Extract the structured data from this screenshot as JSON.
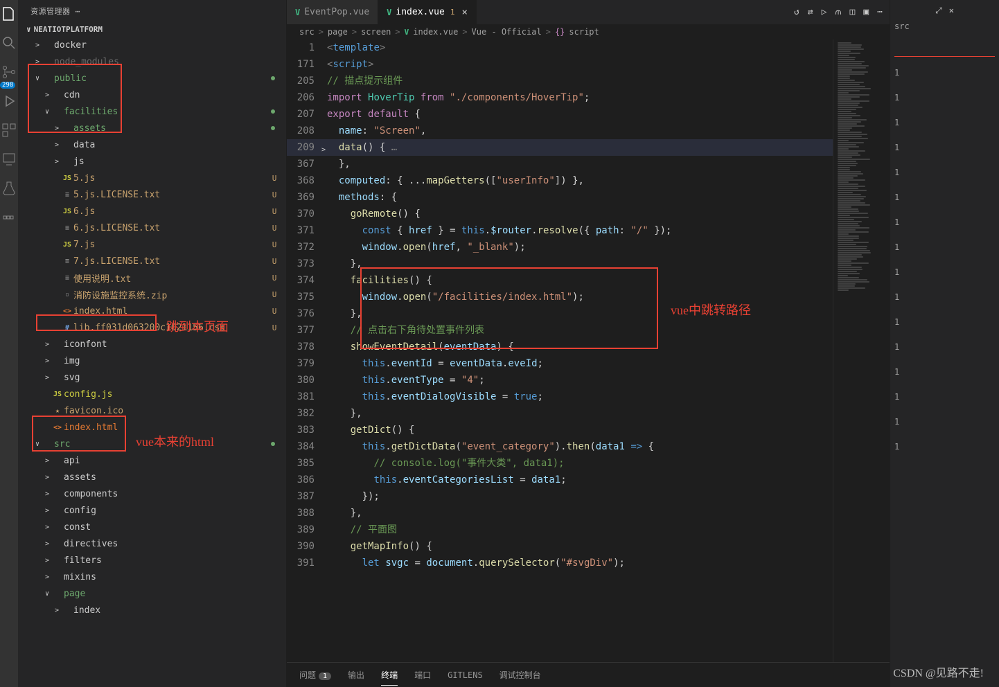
{
  "sidebar": {
    "title": "资源管理器",
    "project": "NEATIOTPLATFORM",
    "badge": "298",
    "tree": [
      {
        "depth": 1,
        "chev": ">",
        "icon": "",
        "cls": "",
        "label": "docker"
      },
      {
        "depth": 1,
        "chev": ">",
        "icon": "",
        "cls": "gray-icon",
        "label": "node_modules",
        "muted": true
      },
      {
        "depth": 1,
        "chev": "∨",
        "icon": "",
        "cls": "green",
        "label": "public",
        "dot": true
      },
      {
        "depth": 2,
        "chev": ">",
        "icon": "",
        "cls": "",
        "label": "cdn"
      },
      {
        "depth": 2,
        "chev": "∨",
        "icon": "",
        "cls": "green",
        "label": "facilities",
        "dot": true
      },
      {
        "depth": 3,
        "chev": ">",
        "icon": "",
        "cls": "green",
        "label": "assets",
        "dot": true
      },
      {
        "depth": 3,
        "chev": ">",
        "icon": "",
        "cls": "",
        "label": "data"
      },
      {
        "depth": 3,
        "chev": ">",
        "icon": "",
        "cls": "",
        "label": "js"
      },
      {
        "depth": 3,
        "chev": "",
        "icon": "JS",
        "cls": "js-icon yellow",
        "label": "5.js",
        "status": "U"
      },
      {
        "depth": 3,
        "chev": "",
        "icon": "≡",
        "cls": "txt-icon yellow",
        "label": "5.js.LICENSE.txt",
        "status": "U"
      },
      {
        "depth": 3,
        "chev": "",
        "icon": "JS",
        "cls": "js-icon yellow",
        "label": "6.js",
        "status": "U"
      },
      {
        "depth": 3,
        "chev": "",
        "icon": "≡",
        "cls": "txt-icon yellow",
        "label": "6.js.LICENSE.txt",
        "status": "U"
      },
      {
        "depth": 3,
        "chev": "",
        "icon": "JS",
        "cls": "js-icon yellow",
        "label": "7.js",
        "status": "U"
      },
      {
        "depth": 3,
        "chev": "",
        "icon": "≡",
        "cls": "txt-icon yellow",
        "label": "7.js.LICENSE.txt",
        "status": "U"
      },
      {
        "depth": 3,
        "chev": "",
        "icon": "≡",
        "cls": "txt-icon yellow",
        "label": "使用说明.txt",
        "status": "U"
      },
      {
        "depth": 3,
        "chev": "",
        "icon": "▫",
        "cls": "gray-icon yellow",
        "label": "消防设施监控系统.zip",
        "status": "U"
      },
      {
        "depth": 3,
        "chev": "",
        "icon": "<>",
        "cls": "html-icon yellow",
        "label": "index.html",
        "status": "U"
      },
      {
        "depth": 3,
        "chev": "",
        "icon": "#",
        "cls": "css-icon yellow",
        "label": "lib.ff031d063200c1021156.css",
        "status": "U"
      },
      {
        "depth": 2,
        "chev": ">",
        "icon": "",
        "cls": "",
        "label": "iconfont"
      },
      {
        "depth": 2,
        "chev": ">",
        "icon": "",
        "cls": "",
        "label": "img"
      },
      {
        "depth": 2,
        "chev": ">",
        "icon": "",
        "cls": "",
        "label": "svg"
      },
      {
        "depth": 2,
        "chev": "",
        "icon": "JS",
        "cls": "js-icon",
        "label": "config.js"
      },
      {
        "depth": 2,
        "chev": "",
        "icon": "★",
        "cls": "star-icon",
        "label": "favicon.ico"
      },
      {
        "depth": 2,
        "chev": "",
        "icon": "<>",
        "cls": "html-icon",
        "label": "index.html"
      },
      {
        "depth": 1,
        "chev": "∨",
        "icon": "",
        "cls": "green",
        "label": "src",
        "dot": true
      },
      {
        "depth": 2,
        "chev": ">",
        "icon": "",
        "cls": "",
        "label": "api"
      },
      {
        "depth": 2,
        "chev": ">",
        "icon": "",
        "cls": "",
        "label": "assets"
      },
      {
        "depth": 2,
        "chev": ">",
        "icon": "",
        "cls": "",
        "label": "components"
      },
      {
        "depth": 2,
        "chev": ">",
        "icon": "",
        "cls": "",
        "label": "config"
      },
      {
        "depth": 2,
        "chev": ">",
        "icon": "",
        "cls": "",
        "label": "const"
      },
      {
        "depth": 2,
        "chev": ">",
        "icon": "",
        "cls": "",
        "label": "directives"
      },
      {
        "depth": 2,
        "chev": ">",
        "icon": "",
        "cls": "",
        "label": "filters"
      },
      {
        "depth": 2,
        "chev": ">",
        "icon": "",
        "cls": "",
        "label": "mixins"
      },
      {
        "depth": 2,
        "chev": "∨",
        "icon": "",
        "cls": "green",
        "label": "page"
      },
      {
        "depth": 3,
        "chev": ">",
        "icon": "",
        "cls": "",
        "label": "index"
      }
    ]
  },
  "tabs": [
    {
      "icon": "V",
      "label": "EventPop.vue",
      "active": false
    },
    {
      "icon": "V",
      "label": "index.vue",
      "active": true,
      "mod": "1"
    }
  ],
  "breadcrumb": [
    "src",
    "page",
    "screen",
    "index.vue",
    "Vue - Official",
    "script"
  ],
  "code": [
    {
      "n": "1",
      "h": "<span class='c-gray'>&lt;</span><span class='c-tag'>template</span><span class='c-gray'>&gt;</span>"
    },
    {
      "n": "171",
      "h": "<span class='c-gray'>&lt;</span><span class='c-tag'>script</span><span class='c-gray'>&gt;</span>"
    },
    {
      "n": "205",
      "h": "<span class='c-comm'>// 描点提示组件</span>"
    },
    {
      "n": "206",
      "h": "<span class='c-kw'>import</span> <span class='c-cls'>HoverTip</span> <span class='c-kw'>from</span> <span class='c-str'>\"./components/HoverTip\"</span><span class='c-punc'>;</span>"
    },
    {
      "n": "207",
      "h": "<span class='c-kw'>export</span> <span class='c-kw'>default</span> <span class='c-punc'>{</span>"
    },
    {
      "n": "208",
      "h": "  <span class='c-prop'>name</span><span class='c-punc'>:</span> <span class='c-str'>\"Screen\"</span><span class='c-punc'>,</span>"
    },
    {
      "n": "209",
      "sel": true,
      "fold": ">",
      "h": "  <span class='c-fn'>data</span><span class='c-punc'>()</span> <span class='c-punc'>{</span><span class='c-gray'> …</span>"
    },
    {
      "n": "367",
      "h": "  <span class='c-punc'>},</span>"
    },
    {
      "n": "368",
      "h": "  <span class='c-prop'>computed</span><span class='c-punc'>:</span> <span class='c-punc'>{ ...</span><span class='c-fn'>mapGetters</span><span class='c-punc'>([</span><span class='c-str'>\"userInfo\"</span><span class='c-punc'>]) },</span>"
    },
    {
      "n": "369",
      "h": "  <span class='c-prop'>methods</span><span class='c-punc'>:</span> <span class='c-punc'>{</span>"
    },
    {
      "n": "370",
      "h": "    <span class='c-fn'>goRemote</span><span class='c-punc'>()</span> <span class='c-punc'>{</span>"
    },
    {
      "n": "371",
      "h": "      <span class='c-const'>const</span> <span class='c-punc'>{</span> <span class='c-var'>href</span> <span class='c-punc'>}</span> <span class='c-op'>=</span> <span class='c-const'>this</span><span class='c-punc'>.</span><span class='c-var'>$router</span><span class='c-punc'>.</span><span class='c-fn'>resolve</span><span class='c-punc'>({</span> <span class='c-prop'>path</span><span class='c-punc'>:</span> <span class='c-str'>\"/\"</span> <span class='c-punc'>});</span>"
    },
    {
      "n": "372",
      "h": "      <span class='c-var'>window</span><span class='c-punc'>.</span><span class='c-fn'>open</span><span class='c-punc'>(</span><span class='c-var'>href</span><span class='c-punc'>,</span> <span class='c-str'>\"_blank\"</span><span class='c-punc'>);</span>"
    },
    {
      "n": "373",
      "h": "    <span class='c-punc'>},</span>"
    },
    {
      "n": "374",
      "h": "    <span class='c-fn'>facilities</span><span class='c-punc'>()</span> <span class='c-punc'>{</span>"
    },
    {
      "n": "375",
      "h": "      <span class='c-var'>window</span><span class='c-punc'>.</span><span class='c-fn'>open</span><span class='c-punc'>(</span><span class='c-str'>\"/facilities/index.html\"</span><span class='c-punc'>);</span>"
    },
    {
      "n": "376",
      "h": "    <span class='c-punc'>},</span>"
    },
    {
      "n": "377",
      "h": "    <span class='c-comm'>// 点击右下角待处置事件列表</span>"
    },
    {
      "n": "378",
      "h": "    <span class='c-fn'>showEventDetail</span><span class='c-punc'>(</span><span class='c-var'>eventData</span><span class='c-punc'>)</span> <span class='c-punc'>{</span>"
    },
    {
      "n": "379",
      "h": "      <span class='c-const'>this</span><span class='c-punc'>.</span><span class='c-var'>eventId</span> <span class='c-op'>=</span> <span class='c-var'>eventData</span><span class='c-punc'>.</span><span class='c-var'>eveId</span><span class='c-punc'>;</span>"
    },
    {
      "n": "380",
      "h": "      <span class='c-const'>this</span><span class='c-punc'>.</span><span class='c-var'>eventType</span> <span class='c-op'>=</span> <span class='c-str'>\"4\"</span><span class='c-punc'>;</span>"
    },
    {
      "n": "381",
      "h": "      <span class='c-const'>this</span><span class='c-punc'>.</span><span class='c-var'>eventDialogVisible</span> <span class='c-op'>=</span> <span class='c-const'>true</span><span class='c-punc'>;</span>"
    },
    {
      "n": "382",
      "h": "    <span class='c-punc'>},</span>"
    },
    {
      "n": "383",
      "h": "    <span class='c-fn'>getDict</span><span class='c-punc'>()</span> <span class='c-punc'>{</span>"
    },
    {
      "n": "384",
      "h": "      <span class='c-const'>this</span><span class='c-punc'>.</span><span class='c-fn'>getDictData</span><span class='c-punc'>(</span><span class='c-str'>\"event_category\"</span><span class='c-punc'>).</span><span class='c-fn'>then</span><span class='c-punc'>(</span><span class='c-var'>data1</span> <span class='c-const'>=&gt;</span> <span class='c-punc'>{</span>"
    },
    {
      "n": "385",
      "h": "        <span class='c-comm'>// console.log(\"事件大类\", data1);</span>"
    },
    {
      "n": "386",
      "h": "        <span class='c-const'>this</span><span class='c-punc'>.</span><span class='c-var'>eventCategoriesList</span> <span class='c-op'>=</span> <span class='c-var'>data1</span><span class='c-punc'>;</span>"
    },
    {
      "n": "387",
      "h": "      <span class='c-punc'>});</span>"
    },
    {
      "n": "388",
      "h": "    <span class='c-punc'>},</span>"
    },
    {
      "n": "389",
      "h": "    <span class='c-comm'>// 平面图</span>"
    },
    {
      "n": "390",
      "h": "    <span class='c-fn'>getMapInfo</span><span class='c-punc'>()</span> <span class='c-punc'>{</span>"
    },
    {
      "n": "391",
      "h": "      <span class='c-const'>let</span> <span class='c-var'>svgc</span> <span class='c-op'>=</span> <span class='c-var'>document</span><span class='c-punc'>.</span><span class='c-fn'>querySelector</span><span class='c-punc'>(</span><span class='c-str'>\"#svgDiv\"</span><span class='c-punc'>);</span>"
    }
  ],
  "terminal": {
    "tabs": [
      "问题",
      "输出",
      "终端",
      "端口",
      "GITLENS",
      "调试控制台"
    ],
    "active": 2,
    "badge": "1"
  },
  "rightcol": {
    "label": "src",
    "nums": [
      "1",
      "1",
      "1",
      "1",
      "1",
      "1",
      "1",
      "1",
      "1",
      "1",
      "1",
      "1",
      "1",
      "1",
      "1",
      "1"
    ]
  },
  "annotations": {
    "a1": "跳到本页面",
    "a2": "vue本来的html",
    "a3": "vue中跳转路径"
  },
  "watermark": "CSDN @见路不走!"
}
